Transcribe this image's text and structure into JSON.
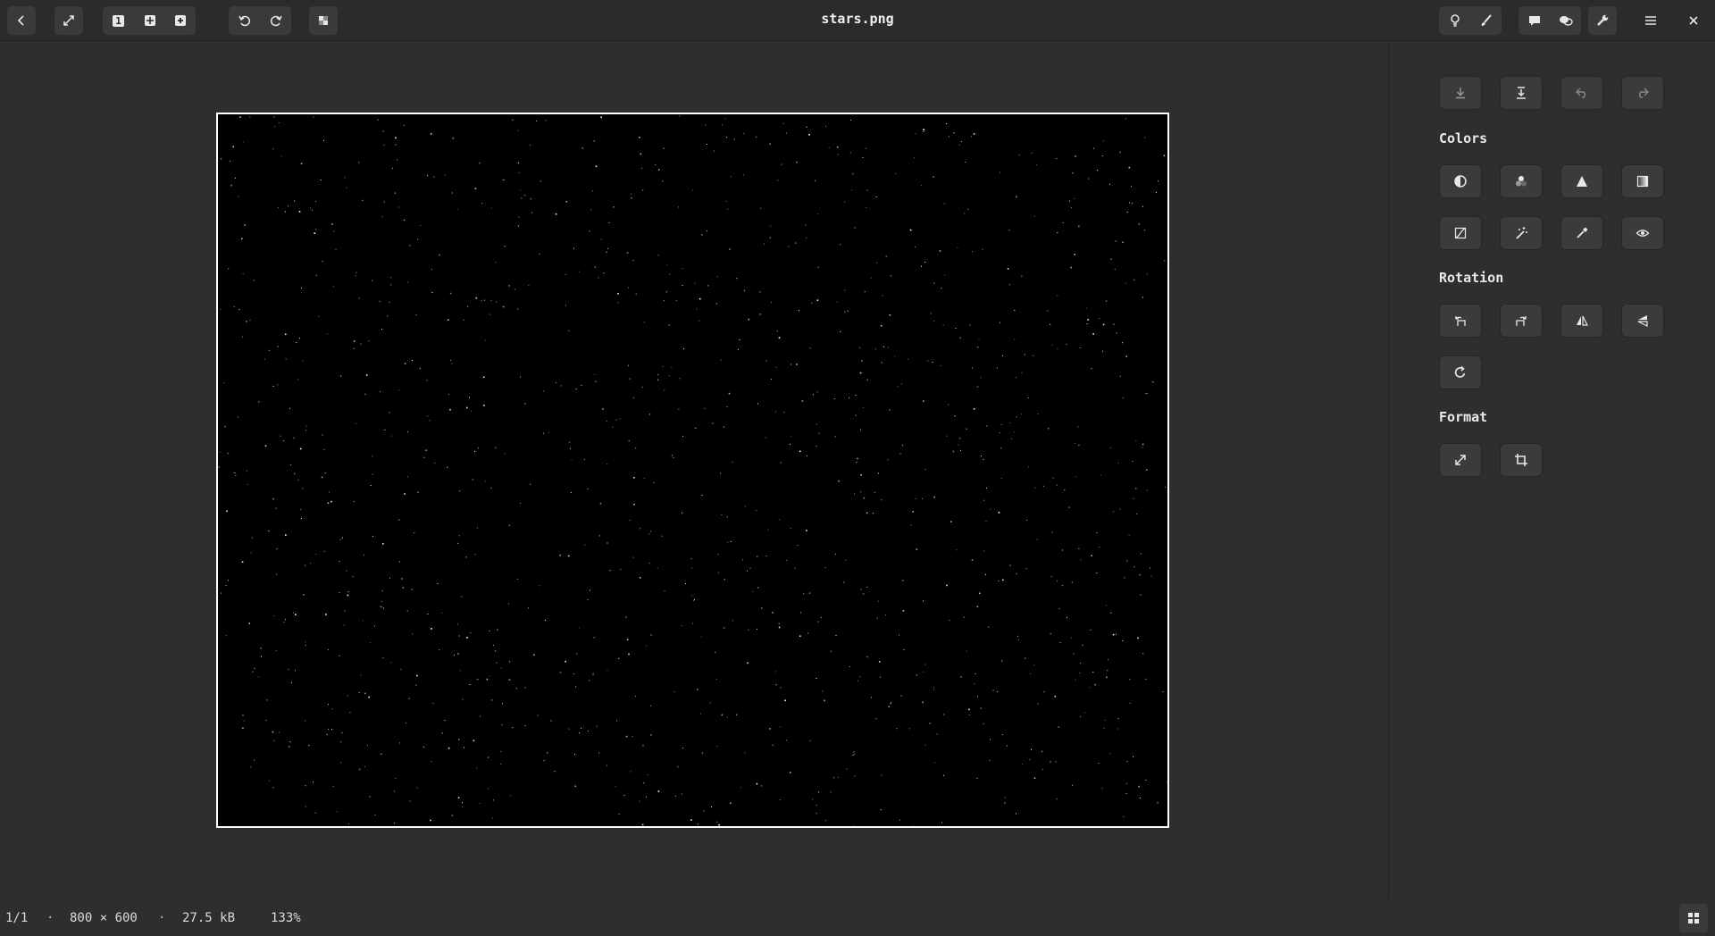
{
  "header": {
    "title": "stars.png",
    "buttons": {
      "back": "back-icon",
      "fullscreen": "expand-icon",
      "single_view": "1",
      "grid_view": "grid-icon",
      "add": "plus-icon",
      "undo": "undo-icon",
      "redo": "redo-icon",
      "transparency": "checkerboard-icon",
      "lightbulb": "lightbulb-icon",
      "paint": "brush-icon",
      "comment": "comment-icon",
      "chat": "chat-bubbles-icon",
      "tools": "wrench-icon",
      "menu": "hamburger-icon",
      "close": "close-icon"
    }
  },
  "sidebar": {
    "sections": {
      "colors": "Colors",
      "rotation": "Rotation",
      "format": "Format"
    }
  },
  "image": {
    "background": "#000000",
    "star_color": "#ffffff",
    "star_count": 1200
  },
  "status": {
    "index": "1/1",
    "separator": "·",
    "dimensions": "800 × 600",
    "filesize": "27.5 kB",
    "zoom": "133%"
  },
  "colors": {
    "accent_border": "#ffffff",
    "button_bg": "#3b3b3b",
    "bg": "#2e2e2e"
  }
}
